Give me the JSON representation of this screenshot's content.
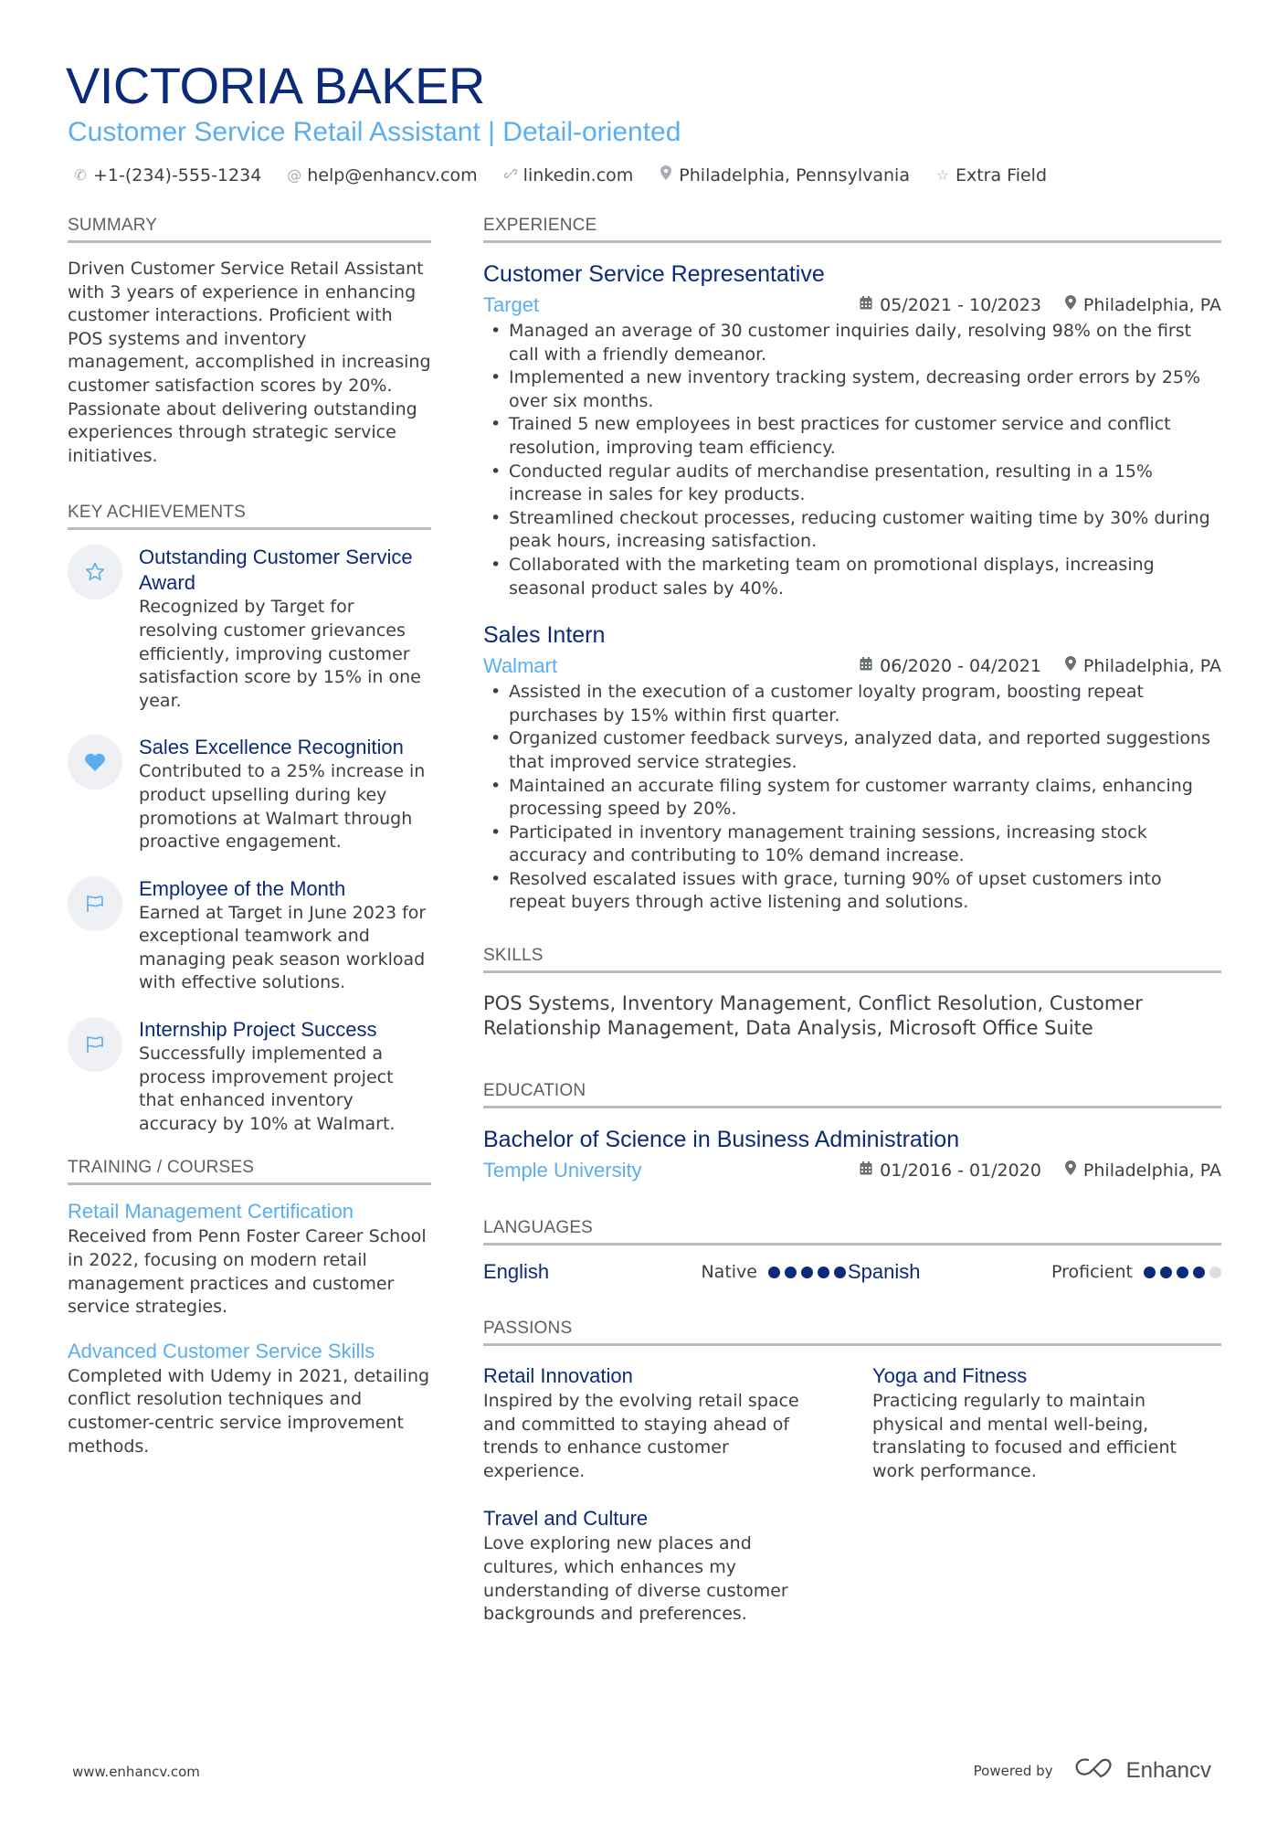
{
  "header": {
    "name": "VICTORIA BAKER",
    "subtitle": "Customer Service Retail Assistant | Detail-oriented",
    "contacts": [
      {
        "icon": "phone-icon",
        "text": "+1-(234)-555-1234"
      },
      {
        "icon": "at-icon",
        "text": "help@enhancv.com"
      },
      {
        "icon": "link-icon",
        "text": "linkedin.com"
      },
      {
        "icon": "location-pin-icon",
        "text": "Philadelphia, Pennsylvania"
      },
      {
        "icon": "star-icon",
        "text": "Extra Field"
      }
    ]
  },
  "summary": {
    "heading": "SUMMARY",
    "text": "Driven Customer Service Retail Assistant with 3 years of experience in enhancing customer interactions. Proficient with POS systems and inventory management, accomplished in increasing customer satisfaction scores by 20%. Passionate about delivering outstanding experiences through strategic service initiatives."
  },
  "achievements": {
    "heading": "KEY ACHIEVEMENTS",
    "items": [
      {
        "icon": "star-icon",
        "title": "Outstanding Customer Service Award",
        "description": "Recognized by Target for resolving customer grievances efficiently, improving customer satisfaction score by 15% in one year."
      },
      {
        "icon": "heart-icon",
        "title": "Sales Excellence Recognition",
        "description": "Contributed to a 25% increase in product upselling during key promotions at Walmart through proactive engagement."
      },
      {
        "icon": "flag-icon",
        "title": "Employee of the Month",
        "description": "Earned at Target in June 2023 for exceptional teamwork and managing peak season workload with effective solutions."
      },
      {
        "icon": "flag-icon",
        "title": "Internship Project Success",
        "description": "Successfully implemented a process improvement project that enhanced inventory accuracy by 10% at Walmart."
      }
    ]
  },
  "training": {
    "heading": "TRAINING / COURSES",
    "items": [
      {
        "title": "Retail Management Certification",
        "description": "Received from Penn Foster Career School in 2022, focusing on modern retail management practices and customer service strategies."
      },
      {
        "title": "Advanced Customer Service Skills",
        "description": "Completed with Udemy in 2021, detailing conflict resolution techniques and customer-centric service improvement methods."
      }
    ]
  },
  "experience": {
    "heading": "EXPERIENCE",
    "jobs": [
      {
        "title": "Customer Service Representative",
        "company": "Target",
        "dates": "05/2021 - 10/2023",
        "location": "Philadelphia, PA",
        "bullets": [
          "Managed an average of 30 customer inquiries daily, resolving 98% on the first call with a friendly demeanor.",
          "Implemented a new inventory tracking system, decreasing order errors by 25% over six months.",
          "Trained 5 new employees in best practices for customer service and conflict resolution, improving team efficiency.",
          "Conducted regular audits of merchandise presentation, resulting in a 15% increase in sales for key products.",
          "Streamlined checkout processes, reducing customer waiting time by 30% during peak hours, increasing satisfaction.",
          "Collaborated with the marketing team on promotional displays, increasing seasonal product sales by 40%."
        ]
      },
      {
        "title": "Sales Intern",
        "company": "Walmart",
        "dates": "06/2020 - 04/2021",
        "location": "Philadelphia, PA",
        "bullets": [
          "Assisted in the execution of a customer loyalty program, boosting repeat purchases by 15% within first quarter.",
          "Organized customer feedback surveys, analyzed data, and reported suggestions that improved service strategies.",
          "Maintained an accurate filing system for customer warranty claims, enhancing processing speed by 20%.",
          "Participated in inventory management training sessions, increasing stock accuracy and contributing to 10% demand increase.",
          "Resolved escalated issues with grace, turning 90% of upset customers into repeat buyers through active listening and solutions."
        ]
      }
    ]
  },
  "skills": {
    "heading": "SKILLS",
    "text": "POS Systems, Inventory Management, Conflict Resolution, Customer Relationship Management, Data Analysis, Microsoft Office Suite"
  },
  "education": {
    "heading": "EDUCATION",
    "items": [
      {
        "degree": "Bachelor of Science in Business Administration",
        "school": "Temple University",
        "dates": "01/2016 - 01/2020",
        "location": "Philadelphia, PA"
      }
    ]
  },
  "languages": {
    "heading": "LANGUAGES",
    "items": [
      {
        "name": "English",
        "level": "Native",
        "rating": 5,
        "max": 5
      },
      {
        "name": "Spanish",
        "level": "Proficient",
        "rating": 4,
        "max": 5
      }
    ]
  },
  "passions": {
    "heading": "PASSIONS",
    "items": [
      {
        "title": "Retail Innovation",
        "description": "Inspired by the evolving retail space and committed to staying ahead of trends to enhance customer experience."
      },
      {
        "title": "Yoga and Fitness",
        "description": "Practicing regularly to maintain physical and mental well-being, translating to focused and efficient work performance."
      },
      {
        "title": "Travel and Culture",
        "description": "Love exploring new places and cultures, which enhances my understanding of diverse customer backgrounds and preferences."
      }
    ]
  },
  "footer": {
    "website": "www.enhancv.com",
    "powered_by": "Powered by",
    "brand": "Enhancv"
  },
  "colors": {
    "primary": "#0b2a7a",
    "accent": "#5aaef0",
    "text": "#3a3f45",
    "rule": "#b9bcbf"
  }
}
